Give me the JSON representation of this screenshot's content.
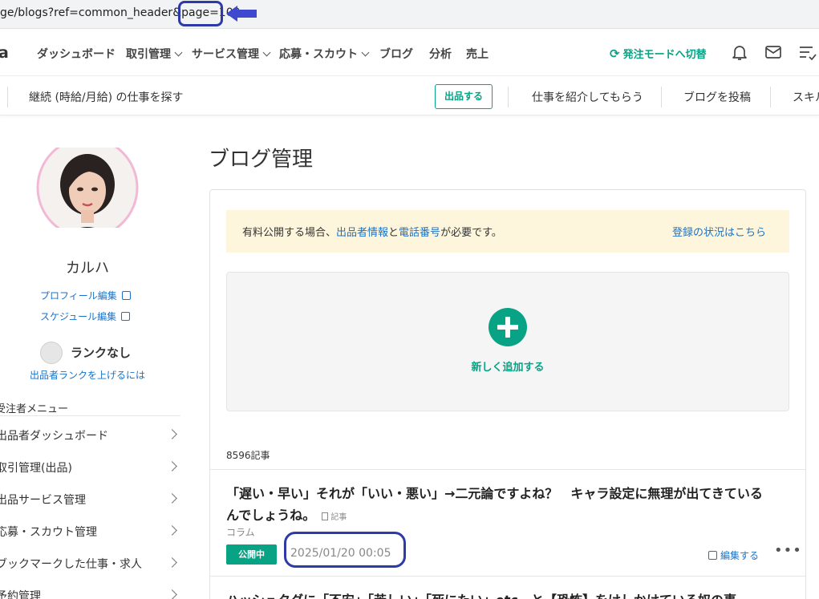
{
  "browser": {
    "url_visible": "ge/blogs?ref=common_header&page=100"
  },
  "header": {
    "logo": "a",
    "nav": [
      {
        "label": "ダッシュボード"
      },
      {
        "label": "取引管理"
      },
      {
        "label": "サービス管理"
      },
      {
        "label": "応募・スカウト"
      },
      {
        "label": "ブログ"
      },
      {
        "label": "分析"
      },
      {
        "label": "売上"
      }
    ],
    "switch_mode": "発注モードへ切替"
  },
  "subheader": {
    "find_job": "継続 (時給/月給) の仕事を探す",
    "sell_button": "出品する",
    "introduce": "仕事を紹介してもらう",
    "post_blog": "ブログを投稿",
    "skill": "スキル"
  },
  "sidebar": {
    "username": "カルハ",
    "profile_edit": "プロフィール編集",
    "schedule_edit": "スケジュール編集",
    "rank": "ランクなし",
    "rank_up": "出品者ランクを上げるには",
    "menu_title": "受注者メニュー",
    "menu": [
      {
        "label": "出品者ダッシュボード"
      },
      {
        "label": "取引管理(出品)"
      },
      {
        "label": "出品サービス管理"
      },
      {
        "label": "応募・スカウト管理"
      },
      {
        "label": "ブックマークした仕事・求人"
      },
      {
        "label": "予約管理"
      }
    ]
  },
  "main": {
    "title": "ブログ管理",
    "notice": {
      "prefix": "有料公開する場合、",
      "link1": "出品者情報",
      "mid": "と",
      "link2": "電話番号",
      "suffix": "が必要です。",
      "status_link": "登録の状況はこちら"
    },
    "add_label": "新しく追加する",
    "count": "8596記事",
    "posts": [
      {
        "title": "「遅い・早い」それが「いい・悪い」→二元論ですよね？　キャラ設定に無理が出てきているんでしょうね。",
        "tag": "記事",
        "category": "コラム",
        "status": "公開中",
        "date": "2025/01/20 00:05",
        "edit": "編集する",
        "more": "•••"
      },
      {
        "title": "ハッシュタグに「不安」「苦しい」「死にたい」etc…と【恐怖】をけしかけている奴の事"
      }
    ]
  },
  "colors": {
    "accent": "#08a284",
    "link": "#1a73c8",
    "annotation": "#2e3aa8",
    "notice_bg": "#fdf6dc"
  }
}
